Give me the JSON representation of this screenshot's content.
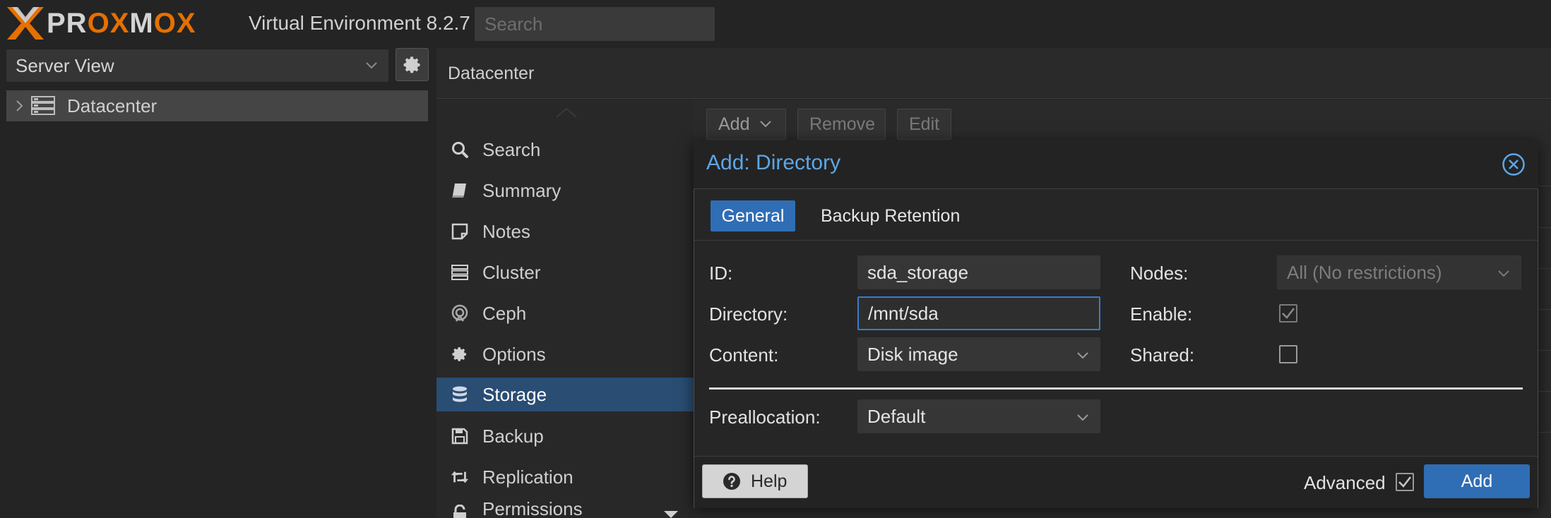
{
  "app": {
    "brand_left": "PR",
    "brand_ox1": "OX",
    "brand_mid": "M",
    "brand_ox2": "OX",
    "version": "Virtual Environment 8.2.7",
    "search_placeholder": "Search",
    "accent_color": "#e57000"
  },
  "tree": {
    "view_selected": "Server View",
    "items": [
      {
        "label": "Datacenter",
        "icon": "datacenter-icon"
      }
    ]
  },
  "content": {
    "title": "Datacenter"
  },
  "nav": {
    "items": [
      {
        "label": "Search",
        "icon": "search-icon"
      },
      {
        "label": "Summary",
        "icon": "book-icon"
      },
      {
        "label": "Notes",
        "icon": "note-icon"
      },
      {
        "label": "Cluster",
        "icon": "server-icon"
      },
      {
        "label": "Ceph",
        "icon": "ceph-icon"
      },
      {
        "label": "Options",
        "icon": "gear-icon"
      },
      {
        "label": "Storage",
        "icon": "database-icon",
        "active": true
      },
      {
        "label": "Backup",
        "icon": "floppy-icon"
      },
      {
        "label": "Replication",
        "icon": "retweet-icon"
      },
      {
        "label": "Permissions",
        "icon": "unlock-icon"
      }
    ]
  },
  "toolbar": {
    "add_label": "Add",
    "remove_label": "Remove",
    "edit_label": "Edit"
  },
  "dialog": {
    "title": "Add: Directory",
    "tabs": [
      {
        "label": "General",
        "active": true
      },
      {
        "label": "Backup Retention",
        "active": false
      }
    ],
    "fields": {
      "id_label": "ID:",
      "id_value": "sda_storage",
      "directory_label": "Directory:",
      "directory_value": "/mnt/sda",
      "content_label": "Content:",
      "content_value": "Disk image",
      "nodes_label": "Nodes:",
      "nodes_value": "All (No restrictions)",
      "enable_label": "Enable:",
      "enable_checked": true,
      "shared_label": "Shared:",
      "shared_checked": false,
      "prealloc_label": "Preallocation:",
      "prealloc_value": "Default"
    },
    "footer": {
      "help_label": "Help",
      "advanced_label": "Advanced",
      "advanced_checked": true,
      "add_label": "Add"
    }
  }
}
